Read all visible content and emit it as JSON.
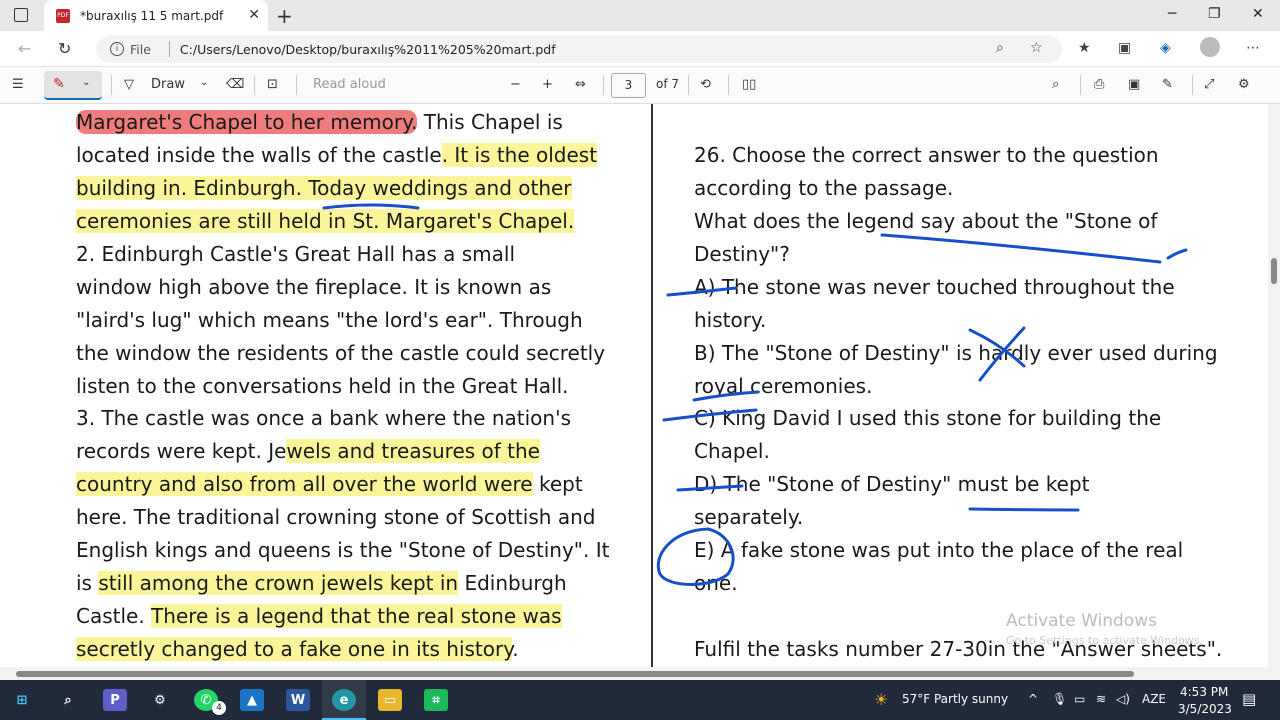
{
  "browser": {
    "tab_title": "*buraxılış 11 5 mart.pdf",
    "url_label": "File",
    "url": "C:/Users/Lenovo/Desktop/buraxılış%2011%205%20mart.pdf"
  },
  "pdf_toolbar": {
    "draw_label": "Draw",
    "read_aloud_label": "Read aloud",
    "page_current": "3",
    "page_total": "of 7"
  },
  "left_column": {
    "lines": [
      "Margaret's Chapel to her memory.",
      " This Chapel is",
      "located inside the walls of the castle",
      ". It is the oldest",
      "building in. Edinburgh",
      ". Today weddings and other",
      "ceremonies are still held in St. Margaret's Chapel.",
      " 2. Edinburgh Castle's Great Hall has a small",
      "window high above the fireplace. It is known as",
      "\"laird's lug\" which means \"the lord's ear\". Through",
      "the window the residents of the castle could secretly",
      "listen to the conversations held in the Great Hall.",
      "3. The castle was once a bank where the nation's",
      "records were kept. Je",
      "wels and treasures of the",
      "country and also from all over the world were",
      " kept",
      "here. The traditional crowning stone of Scottish and",
      "English kings and queens is the \"Stone of Destiny\". It",
      "is ",
      "still among the crown jewels kept in",
      " Edinburgh",
      "Castle. ",
      "There is a legend that the real stone was",
      "secretly changed to a fake one in its history",
      "."
    ]
  },
  "right_column": {
    "lines": [
      "26. Choose the correct answer to the question",
      "according to the passage.",
      "What does the legend say about the \"Stone of",
      "Destiny\"?",
      "A) The stone was never touched throughout the",
      "history.",
      "B) The \"Stone of Destiny\" is hardly ever used during",
      "royal ceremonies.",
      "C) King David I used this stone for building the",
      "Chapel.",
      "D) The \"Stone of Destiny\" must be kept",
      "separately.",
      "E) A fake stone was put into the place of the real",
      "one.",
      "Fulfil the tasks number 27-30in the \"Answer sheets\"."
    ]
  },
  "watermark": {
    "title": "Activate Windows",
    "subtitle": "Go to Settings to activate Windows."
  },
  "taskbar": {
    "weather": "57°F  Partly sunny",
    "language": "AZE",
    "time": "4:53 PM",
    "date": "3/5/2023",
    "whatsapp_badge": "4"
  },
  "colors": {
    "highlight_yellow": "#fbf59a",
    "highlight_red": "#ef7c7c",
    "ink_blue": "#1550c8",
    "taskbar": "#202a3a"
  }
}
